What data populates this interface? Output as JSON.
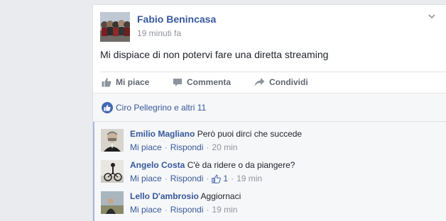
{
  "post": {
    "author": "Fabio Benincasa",
    "timestamp": "19 minuti fa",
    "text": "Mi dispiace di non potervi fare una diretta streaming",
    "menu_icon": "chevron-down-icon"
  },
  "actions": {
    "like": {
      "label": "Mi piace",
      "icon": "thumbs-up-icon"
    },
    "comment": {
      "label": "Commenta",
      "icon": "comment-icon"
    },
    "share": {
      "label": "Condividi",
      "icon": "share-icon"
    }
  },
  "likes_summary": {
    "text": "Ciro Pellegrino e altri 11",
    "icon": "like-reaction-icon"
  },
  "comments": [
    {
      "author": "Emilio Magliano",
      "text": "Però puoi dirci che succede",
      "like": "Mi piace",
      "reply": "Rispondi",
      "time": "20 min"
    },
    {
      "author": "Angelo Costa",
      "text": "C'è da ridere o da piangere?",
      "like": "Mi piace",
      "reply": "Rispondi",
      "likes_count": "1",
      "time": "19 min"
    },
    {
      "author": "Lello D'ambrosio",
      "text": "Aggiornaci",
      "like": "Mi piace",
      "reply": "Rispondi",
      "time": "19 min"
    }
  ],
  "colors": {
    "link": "#365899",
    "accent": "#4267b2",
    "page_bg": "#e9ebee",
    "comments_bg": "#f6f7f9",
    "thread_bar": "#a8b9da"
  }
}
